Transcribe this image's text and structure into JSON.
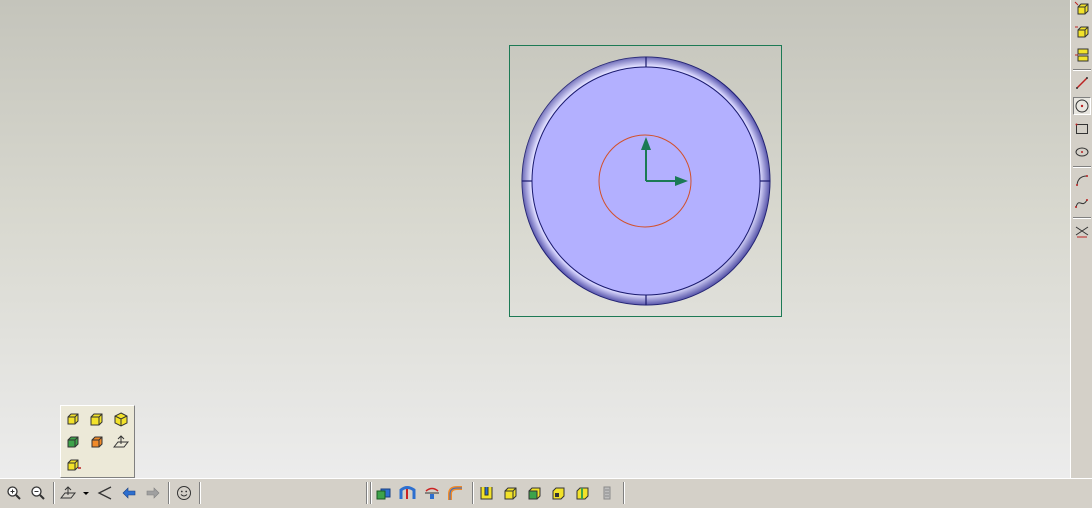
{
  "viewport": {
    "background_top": "#c4c4bb",
    "background_bottom": "#ececec",
    "model": {
      "shape": "cylinder-top-view",
      "fill_color": "#b3b0ff",
      "edge_color": "#1a1a6e",
      "frame_color": "#1d7a55",
      "sketch_circle_color": "#d2502a",
      "axis_color": "#1b7a55"
    }
  },
  "right_toolbar": {
    "buttons": [
      {
        "icon": "feature-cube-icon"
      },
      {
        "icon": "feature-cube-add-icon"
      },
      {
        "icon": "feature-cube-multi-icon"
      },
      {
        "icon": "sketch-line-icon"
      },
      {
        "icon": "sketch-circle-icon",
        "pressed": true
      },
      {
        "icon": "sketch-rectangle-icon"
      },
      {
        "icon": "sketch-ellipse-icon"
      },
      {
        "icon": "sketch-arc-icon"
      },
      {
        "icon": "sketch-spline-icon"
      },
      {
        "icon": "sketch-trim-icon"
      }
    ]
  },
  "bottom_toolbar": {
    "left_buttons": [
      {
        "icon": "zoom-in-icon"
      },
      {
        "icon": "zoom-out-icon"
      },
      {
        "icon": "view-plane-dropdown-icon"
      },
      {
        "icon": "view-orient-icon"
      },
      {
        "icon": "back-arrow-icon"
      },
      {
        "icon": "forward-arrow-icon"
      },
      {
        "icon": "smiley-icon"
      }
    ],
    "center_buttons": [
      {
        "icon": "shaded-view-icon"
      },
      {
        "icon": "sweep-icon"
      },
      {
        "icon": "revolve-icon"
      },
      {
        "icon": "pipe-icon"
      },
      {
        "icon": "cut-icon"
      },
      {
        "icon": "box-yellow-icon"
      },
      {
        "icon": "box-green-icon"
      },
      {
        "icon": "box-frame-icon"
      },
      {
        "icon": "box-split-icon"
      },
      {
        "icon": "scroll-icon"
      }
    ]
  },
  "view_flyout": {
    "buttons": [
      {
        "icon": "front-view-icon"
      },
      {
        "icon": "right-view-icon"
      },
      {
        "icon": "iso-view-icon"
      },
      {
        "icon": "back-view-icon"
      },
      {
        "icon": "left-view-icon"
      },
      {
        "icon": "plane-view-icon"
      },
      {
        "icon": "bottom-view-icon"
      }
    ]
  }
}
